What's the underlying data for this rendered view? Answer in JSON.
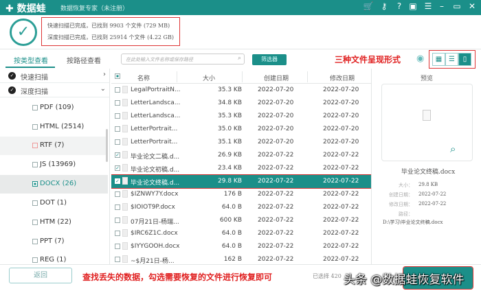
{
  "app": {
    "logo": "✚ 数据蛙",
    "title": "数据恢复专家（未注册）",
    "titlebar_icons": [
      "cart-icon",
      "key-icon",
      "help-icon",
      "save-icon",
      "menu-icon",
      "minimize-icon",
      "maximize-icon",
      "close-icon"
    ]
  },
  "scan": {
    "quick": "快速扫描已完成，已找到 9903 个文件 (729 MB)",
    "deep": "深度扫描已完成，已找到 25914 个文件 (4.22 GB)"
  },
  "tabs": [
    "按类型查看",
    "按路径查看"
  ],
  "sidebar": {
    "scans": [
      "快速扫描",
      "深度扫描"
    ],
    "types": [
      "PDF (109)",
      "HTML (2514)",
      "RTF (7)",
      "JS (13969)",
      "DOCX (26)",
      "DOT (1)",
      "HTM (22)",
      "PPT (7)",
      "REG (1)"
    ]
  },
  "search": {
    "placeholder": "在此处输入文件名称或保存路径"
  },
  "filter_label": "筛选器",
  "annotation_view": "三种文件呈现形式",
  "table": {
    "headers": [
      "名称",
      "大小",
      "创建日期",
      "修改日期"
    ],
    "rows": [
      [
        "LegalPortraitN...",
        "35.3 KB",
        "2022-07-20",
        "2022-07-20",
        false
      ],
      [
        "LetterLandsca...",
        "34.8 KB",
        "2022-07-20",
        "2022-07-20",
        false
      ],
      [
        "LetterLandsca...",
        "35.3 KB",
        "2022-07-20",
        "2022-07-20",
        false
      ],
      [
        "LetterPortrait...",
        "35.0 KB",
        "2022-07-20",
        "2022-07-20",
        false
      ],
      [
        "LetterPortrait...",
        "35.1 KB",
        "2022-07-20",
        "2022-07-20",
        false
      ],
      [
        "毕业论文二稿.d...",
        "26.9 KB",
        "2022-07-22",
        "2022-07-22",
        true
      ],
      [
        "毕业论文初稿.d...",
        "23.4 KB",
        "2022-07-22",
        "2022-07-22",
        true
      ],
      [
        "毕业论文终稿.d...",
        "29.8 KB",
        "2022-07-22",
        "2022-07-22",
        true
      ],
      [
        "$IZNWY7Y.docx",
        "176  B",
        "2022-07-22",
        "2022-07-22",
        false
      ],
      [
        "$IOIOT9P.docx",
        "64.0  B",
        "2022-07-22",
        "2022-07-22",
        false
      ],
      [
        "07月21日-杨瑞...",
        "600 KB",
        "2022-07-22",
        "2022-07-22",
        false
      ],
      [
        "$IRC6Z1C.docx",
        "64.0  B",
        "2022-07-22",
        "2022-07-22",
        false
      ],
      [
        "$IYYGOOH.docx",
        "64.0  B",
        "2022-07-22",
        "2022-07-22",
        false
      ],
      [
        "~$月21日-杨...",
        "162  B",
        "2022-07-22",
        "2022-07-22",
        false
      ]
    ]
  },
  "preview": {
    "title": "预览",
    "name": "毕业论文终稿.docx",
    "size_label": "大小：",
    "size": "29.8 KB",
    "created_label": "创建日期：",
    "created": "2022-07-22",
    "modified_label": "修改日期：",
    "modified": "2022-07-22",
    "path_label": "路径：",
    "path": "D:\\学习\\毕业论文终稿.docx"
  },
  "footer": {
    "back": "返回",
    "annotation": "查找丢失的数据，勾选需要恢复的文件进行恢复即可",
    "selected": "已选择 420",
    "watermark": "头条 @数据蛙恢复软件"
  },
  "colors": {
    "brand": "#1b8f89",
    "annotation": "#e02020"
  }
}
